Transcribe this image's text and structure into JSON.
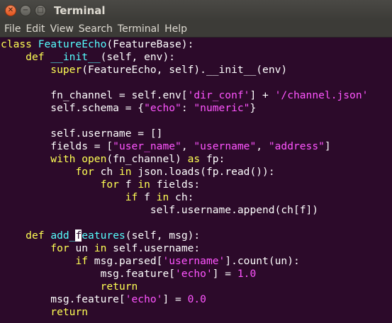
{
  "window": {
    "title": "Terminal"
  },
  "menu": [
    "File",
    "Edit",
    "View",
    "Search",
    "Terminal",
    "Help"
  ],
  "colors": {
    "background": "#2c0a2a",
    "keyword": "#ffff54",
    "function": "#55ffff",
    "string": "#ff55ff",
    "text": "#ffffff"
  },
  "code": {
    "l1": [
      "class ",
      "FeatureEcho",
      "(FeatureBase):"
    ],
    "l2": [
      "    ",
      "def ",
      "__init__",
      "(self, env):"
    ],
    "l3": [
      "        ",
      "super",
      "(FeatureEcho, self).__init__(env)"
    ],
    "l5": [
      "        fn_channel = self.env[",
      "'dir_conf'",
      "] + ",
      "'/channel.json'"
    ],
    "l6": [
      "        self.schema = {",
      "\"echo\"",
      ": ",
      "\"numeric\"",
      "}"
    ],
    "l8": [
      "        self.username = []"
    ],
    "l9": [
      "        fields = [",
      "\"user_name\"",
      ", ",
      "\"username\"",
      ", ",
      "\"address\"",
      "]"
    ],
    "l10": [
      "        ",
      "with ",
      "open",
      "(fn_channel) ",
      "as ",
      "fp:"
    ],
    "l11": [
      "            ",
      "for ",
      "ch ",
      "in ",
      "json.loads(fp.read()):"
    ],
    "l12": [
      "                ",
      "for ",
      "f ",
      "in ",
      "fields:"
    ],
    "l13": [
      "                    ",
      "if ",
      "f ",
      "in ",
      "ch:"
    ],
    "l14": [
      "                        self.username.append(ch[f])"
    ],
    "l16": [
      "    ",
      "def ",
      "add_",
      "f",
      "eatures",
      "(self, msg):"
    ],
    "l17": [
      "        ",
      "for ",
      "un ",
      "in ",
      "self.username:"
    ],
    "l18": [
      "            ",
      "if ",
      "msg.parsed[",
      "'username'",
      "].count(un):"
    ],
    "l19": [
      "                msg.feature[",
      "'echo'",
      "] = ",
      "1.0"
    ],
    "l20": [
      "                ",
      "return"
    ],
    "l21": [
      "        msg.feature[",
      "'echo'",
      "] = ",
      "0.0"
    ],
    "l22": [
      "        ",
      "return"
    ]
  }
}
